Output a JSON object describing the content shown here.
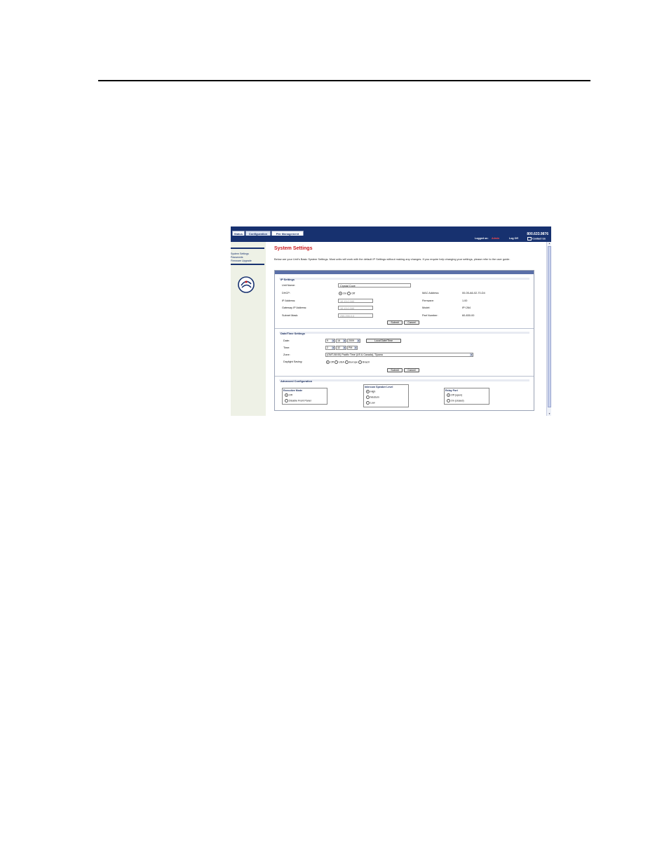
{
  "tabs": [
    {
      "label": "Status"
    },
    {
      "label": "Configuration"
    },
    {
      "label": "File Management"
    }
  ],
  "header": {
    "phone": "800.633.9876",
    "logged_on_label": "Logged on:",
    "logged_on_user": "Admin",
    "log_off": "Log Off",
    "contact_us": "Contact Us"
  },
  "nav": {
    "items": [
      "System Settings",
      "Passwords",
      "Firmware Upgrade"
    ]
  },
  "page": {
    "title": "System Settings",
    "intro": "Below are your Unit's Basic System Settings. Most units will work with the default IP Settings without making any changes. If you require help changing your settings, please refer to the user guide."
  },
  "ip_settings": {
    "heading": "IP Settings",
    "unit_name_label": "Unit Name:",
    "unit_name_value": "Crystal Cove",
    "dhcp_label": "DHCP:",
    "dhcp_on": "On",
    "dhcp_off": "Off",
    "ip_label": "IP Address:",
    "ip_value": "10.13.0.160",
    "gateway_label": "Gateway IP Address:",
    "gateway_value": "10.13.0.160",
    "subnet_label": "Subnet Mask:",
    "subnet_value": "255.255.0.0",
    "mac_label": "MAC Address:",
    "mac_value": "00-05-A6-02-70-D4",
    "firmware_label": "Firmware:",
    "firmware_value": "1.00",
    "model_label": "Model:",
    "model_value": "IPI 264",
    "part_label": "Part Number:",
    "part_value": "60-830-00",
    "submit": "Submit",
    "cancel": "Cancel"
  },
  "datetime": {
    "heading": "Date/Time Settings",
    "date_label": "Date:",
    "month": "9",
    "day": "16",
    "year": "2009",
    "local_button": "Local Date/Time",
    "time_label": "Time:",
    "hour": "2",
    "minute": "32",
    "ampm": "PM",
    "zone_label": "Zone:",
    "zone_value": "(GMT-08:00) Pacific Time (US & Canada), Tijuana",
    "dst_label": "Daylight Saving:",
    "dst_options": [
      "Off",
      "USA",
      "Europe",
      "Brazil"
    ],
    "submit": "Submit",
    "cancel": "Cancel"
  },
  "advanced": {
    "heading": "Advanced Configuration",
    "executive_title": "Executive Mode",
    "executive_options": [
      "Off",
      "Disable Front Panel"
    ],
    "speaker_title": "Intercom Speaker Level",
    "speaker_options": [
      "High",
      "Medium",
      "Low"
    ],
    "relay_title": "Relay Port",
    "relay_options": [
      "Off (open)",
      "On (closed)"
    ]
  }
}
